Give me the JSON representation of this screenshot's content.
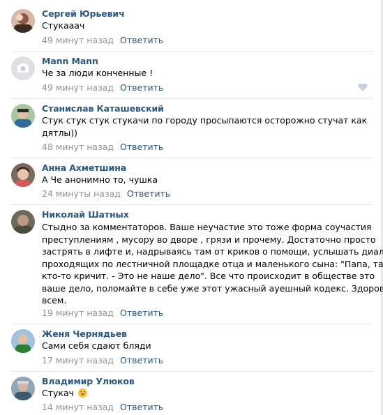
{
  "reply_label": "Ответить",
  "colors": {
    "author": "#2a5885",
    "time": "#939393",
    "divider": "#e7e8ec"
  },
  "comments": [
    {
      "author": "Сергей Юрьевич",
      "lines": [
        "Стукааач"
      ],
      "time": "49 минут назад",
      "avatar_icon": "user-photo-avatar"
    },
    {
      "author": "Mann Mann",
      "lines": [
        "Че за люди конченные !"
      ],
      "time": "49 минут назад",
      "avatar_icon": "camera-placeholder-avatar"
    },
    {
      "author": "Станислав Каташевский",
      "lines": [
        "Стук стук стук стукачи по городу просыпаются осторожно стучат как",
        "дятлы))"
      ],
      "time": "48 минут назад",
      "avatar_icon": "user-photo-avatar"
    },
    {
      "author": "Анна Ахметшина",
      "lines": [
        "А Че анонимно то, чушка"
      ],
      "time": "24 минуты назад",
      "avatar_icon": "user-photo-avatar"
    },
    {
      "author": "Николай Шатных",
      "lines": [
        "Стыдно за комментаторов. Ваше неучастие это тоже форма соучастия",
        "преступлениям , мусору во дворе , грязи и прочему. Достаточно просто",
        "застрять в лифте и, надрываясь там от криков о помощи, услышать диалог",
        "проходящих по лестничной площадке отца и маленького сына: \"Папа, там",
        "кто-то кричит. - Это не наше дело\". Все что происходит в обществе это",
        "ваше дело, поломайте в себе уже этот ужасный ауешный кодекс. Здоровья",
        "всем."
      ],
      "time": "19 минут назад",
      "avatar_icon": "user-photo-avatar"
    },
    {
      "author": "Женя Чернядьев",
      "lines": [
        "Сами себя сдают бляди"
      ],
      "time": "17 минут назад",
      "avatar_icon": "user-photo-avatar"
    },
    {
      "author": "Владимир Улюков",
      "lines": [
        "Стукач"
      ],
      "time": "14 минут назад",
      "avatar_icon": "user-photo-avatar",
      "emoji": "laughing-emoji"
    }
  ]
}
